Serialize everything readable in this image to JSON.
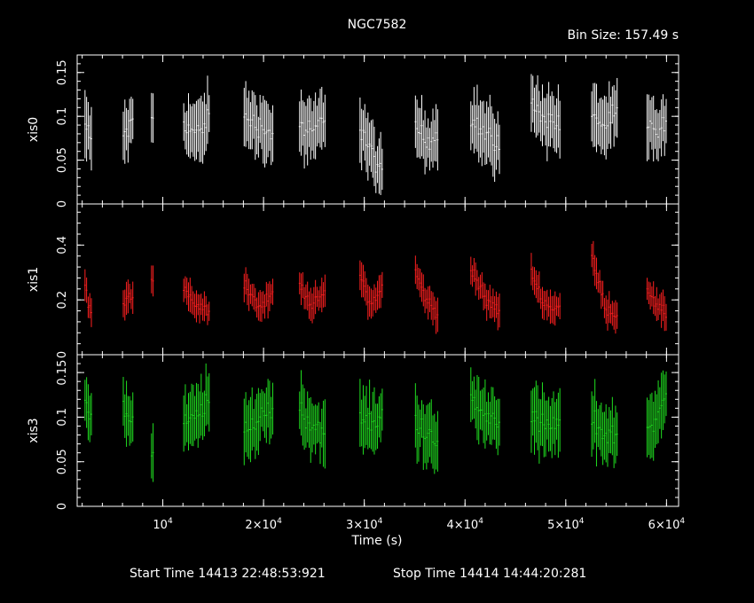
{
  "chart_data": {
    "type": "scatter",
    "title": "NGC7582",
    "bin_size_label": "Bin Size: 157.49 s",
    "xlabel": "Time (s)",
    "x_tick_labels": [
      "10^4",
      "2×10^4",
      "3×10^4",
      "4×10^4",
      "5×10^4",
      "6×10^4"
    ],
    "x_ticks": [
      10000,
      20000,
      30000,
      40000,
      50000,
      60000
    ],
    "xlim": [
      1500,
      61200
    ],
    "footer_start": "Start Time 14413 22:48:53:921",
    "footer_stop": "Stop Time 14414 14:44:20:281",
    "segments": [
      [
        2200,
        3000
      ],
      [
        6000,
        7200
      ],
      [
        8800,
        9200
      ],
      [
        12000,
        14800
      ],
      [
        18000,
        21000
      ],
      [
        23500,
        26200
      ],
      [
        29500,
        32000
      ],
      [
        35000,
        37500
      ],
      [
        40500,
        43500
      ],
      [
        46500,
        49500
      ],
      [
        52500,
        55200
      ],
      [
        58000,
        60200
      ]
    ],
    "error_bar_style": "vertical error bars per bin, small horizontal bin-width bars",
    "panels": [
      {
        "name": "xis0",
        "color": "#ffffff",
        "ylim": [
          0,
          0.17
        ],
        "y_ticks": [
          0,
          0.05,
          0.1,
          0.15
        ],
        "y_tick_labels": [
          "0",
          "0.05",
          "0.1",
          "0.15"
        ],
        "segment_values": [
          [
            0.09,
            0.07
          ],
          [
            0.08,
            0.09
          ],
          [
            0.1
          ],
          [
            0.09,
            0.08,
            0.1
          ],
          [
            0.1,
            0.09,
            0.08
          ],
          [
            0.09,
            0.08,
            0.1
          ],
          [
            0.09,
            0.06,
            0.03
          ],
          [
            0.09,
            0.07,
            0.08
          ],
          [
            0.1,
            0.08,
            0.07
          ],
          [
            0.11,
            0.1,
            0.09
          ],
          [
            0.1,
            0.09,
            0.1
          ],
          [
            0.09,
            0.08,
            0.09
          ]
        ],
        "typical_error": 0.03
      },
      {
        "name": "xis1",
        "color": "#ff2020",
        "ylim": [
          0,
          0.55
        ],
        "y_ticks": [
          0,
          0.2,
          0.4
        ],
        "y_tick_labels": [
          "0",
          "0.2",
          "0.4"
        ],
        "segment_values": [
          [
            0.24,
            0.15
          ],
          [
            0.18,
            0.22
          ],
          [
            0.28
          ],
          [
            0.25,
            0.18,
            0.16
          ],
          [
            0.27,
            0.17,
            0.22
          ],
          [
            0.26,
            0.18,
            0.22
          ],
          [
            0.3,
            0.18,
            0.25
          ],
          [
            0.3,
            0.2,
            0.15
          ],
          [
            0.32,
            0.2,
            0.16
          ],
          [
            0.3,
            0.18,
            0.17
          ],
          [
            0.36,
            0.18,
            0.14
          ],
          [
            0.25,
            0.17,
            0.15
          ]
        ],
        "typical_error": 0.05
      },
      {
        "name": "xis3",
        "color": "#20e020",
        "ylim": [
          0,
          0.17
        ],
        "y_ticks": [
          0,
          0.05,
          0.1,
          0.15
        ],
        "y_tick_labels": [
          "0",
          "0.05",
          "0.1",
          "0.15"
        ],
        "segment_values": [
          [
            0.12,
            0.1
          ],
          [
            0.11,
            0.09
          ],
          [
            0.06
          ],
          [
            0.09,
            0.1,
            0.12
          ],
          [
            0.08,
            0.1,
            0.11
          ],
          [
            0.11,
            0.09,
            0.08
          ],
          [
            0.1,
            0.09,
            0.1
          ],
          [
            0.1,
            0.08,
            0.07
          ],
          [
            0.12,
            0.1,
            0.1
          ],
          [
            0.1,
            0.09,
            0.09
          ],
          [
            0.1,
            0.08,
            0.08
          ],
          [
            0.09,
            0.1,
            0.12
          ]
        ],
        "typical_error": 0.03
      }
    ]
  }
}
